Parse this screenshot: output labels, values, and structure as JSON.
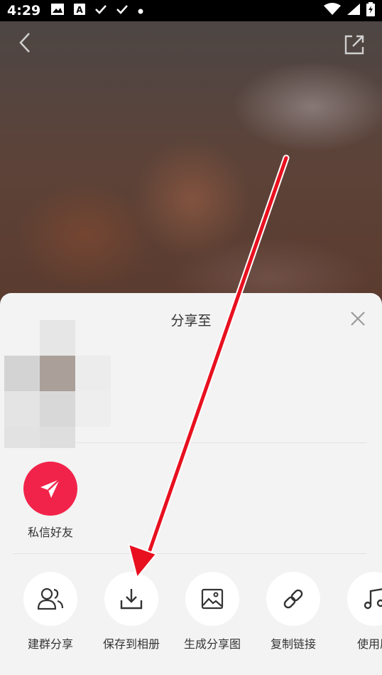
{
  "status_bar": {
    "time": "4:29",
    "icons": [
      "image-icon",
      "a-letter-icon",
      "check-icon",
      "check-icon",
      "dot-icon",
      "wifi-icon",
      "signal-icon",
      "battery-icon"
    ]
  },
  "nav": {
    "back_icon": "chevron-left-icon",
    "share_icon": "external-share-icon"
  },
  "share_sheet": {
    "title": "分享至",
    "close_icon": "close-icon",
    "direct_message": {
      "label": "私信好友",
      "icon": "paper-plane-icon",
      "color": "#f2234a"
    },
    "actions": [
      {
        "label": "建群分享",
        "icon": "group-users-icon"
      },
      {
        "label": "保存到相册",
        "icon": "download-icon"
      },
      {
        "label": "生成分享图",
        "icon": "image-icon"
      },
      {
        "label": "复制链接",
        "icon": "link-icon"
      },
      {
        "label": "使用原",
        "icon": "music-note-icon"
      }
    ]
  },
  "annotation": {
    "arrow_color": "#e8101f"
  }
}
